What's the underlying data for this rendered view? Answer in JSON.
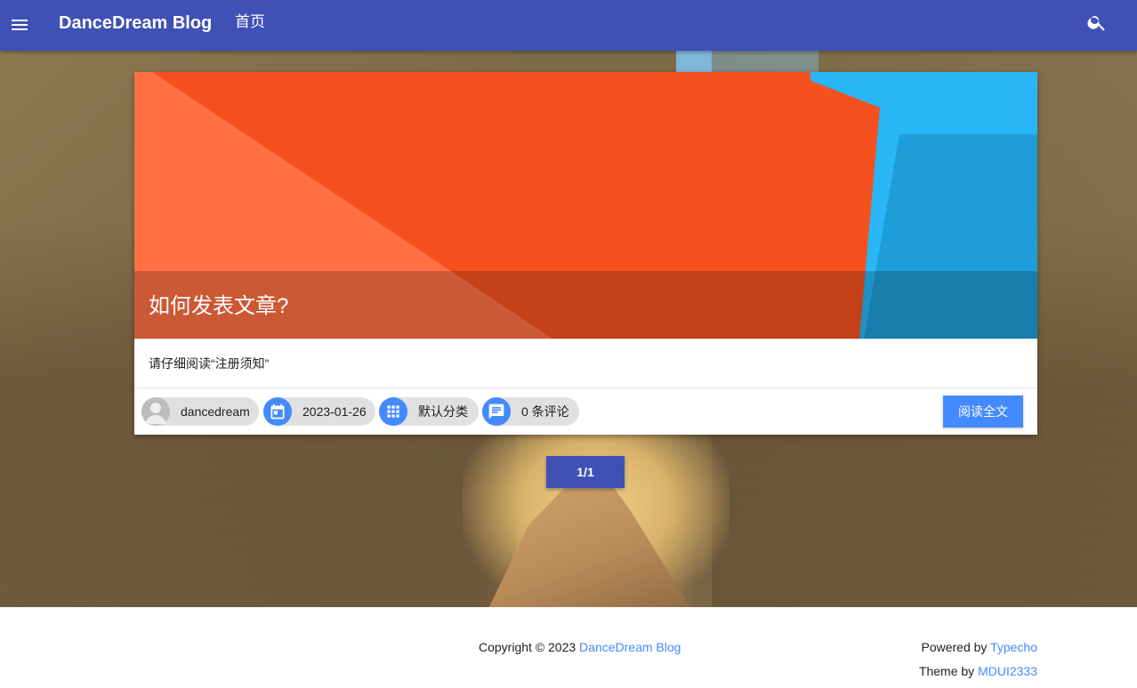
{
  "appbar": {
    "menu_icon": "menu-icon",
    "brand": "DanceDream Blog",
    "nav_home": "首页",
    "search_icon": "search-icon",
    "bg_color": "#3f51b5"
  },
  "post": {
    "title": "如何发表文章?",
    "summary": "请仔细阅读“注册须知”",
    "author": "dancedream",
    "date": "2023-01-26",
    "category": "默认分类",
    "comments": "0 条评论",
    "read_more": "阅读全文",
    "accent_color": "#448aff"
  },
  "pagination": {
    "label": "1/1"
  },
  "footer": {
    "copyright_prefix": "Copyright © 2023 ",
    "copyright_link": "DanceDream Blog",
    "powered_prefix": "Powered by ",
    "powered_link": "Typecho",
    "theme_prefix": "Theme by ",
    "theme_link": "MDUI2333"
  }
}
